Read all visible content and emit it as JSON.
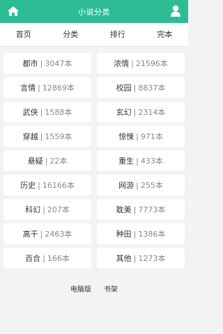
{
  "header": {
    "title": "小说分类",
    "home_icon": "home-icon",
    "user_icon": "user-icon",
    "bg_color": "#2ebc95"
  },
  "nav": {
    "items": [
      {
        "label": "首页"
      },
      {
        "label": "分类"
      },
      {
        "label": "排行"
      },
      {
        "label": "完本"
      }
    ]
  },
  "categories": {
    "separator": "|",
    "items": [
      {
        "name": "都市",
        "count": "3047本"
      },
      {
        "name": "浓情",
        "count": "21596本"
      },
      {
        "name": "言情",
        "count": "12869本"
      },
      {
        "name": "校园",
        "count": "8837本"
      },
      {
        "name": "武侠",
        "count": "1588本"
      },
      {
        "name": "玄幻",
        "count": "2314本"
      },
      {
        "name": "穿越",
        "count": "1559本"
      },
      {
        "name": "惊悚",
        "count": "971本"
      },
      {
        "name": "悬疑",
        "count": "22本"
      },
      {
        "name": "重生",
        "count": "433本"
      },
      {
        "name": "历史",
        "count": "16166本"
      },
      {
        "name": "网游",
        "count": "255本"
      },
      {
        "name": "科幻",
        "count": "207本"
      },
      {
        "name": "耽美",
        "count": "7773本"
      },
      {
        "name": "高干",
        "count": "2463本"
      },
      {
        "name": "种田",
        "count": "1386本"
      },
      {
        "name": "百合",
        "count": "166本"
      },
      {
        "name": "其他",
        "count": "1273本"
      }
    ]
  },
  "footer": {
    "links": [
      {
        "label": "电脑版"
      },
      {
        "label": "书架"
      }
    ]
  }
}
